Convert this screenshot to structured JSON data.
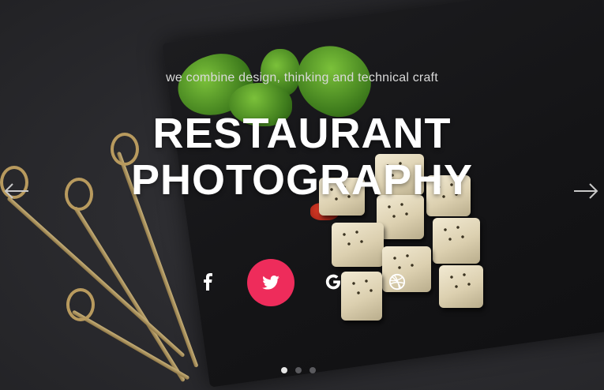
{
  "hero": {
    "tagline": "we combine design, thinking and technical craft",
    "title_line1": "RESTAURANT",
    "title_line2": "PHOTOGRAPHY"
  },
  "navigation": {
    "prev_icon": "arrow-left-icon",
    "next_icon": "arrow-right-icon"
  },
  "social": [
    {
      "name": "facebook",
      "icon": "facebook-icon"
    },
    {
      "name": "twitter",
      "icon": "twitter-icon",
      "active": true,
      "color": "#ee2c5b"
    },
    {
      "name": "google",
      "icon": "google-icon"
    },
    {
      "name": "dribbble",
      "icon": "dribbble-icon"
    }
  ],
  "slider": {
    "slide_count": 3,
    "active_slide": 1
  }
}
